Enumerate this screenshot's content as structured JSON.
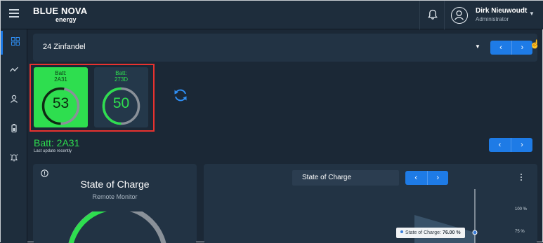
{
  "brand": {
    "name_line1": "BLUE NOVA",
    "name_line2": "energy"
  },
  "user": {
    "name": "Dirk Nieuwoudt",
    "role": "Administrator"
  },
  "icons": {
    "menu": "hamburger-icon",
    "bell": "bell-icon",
    "avatar": "user-icon",
    "sidebar": [
      "dashboard-icon",
      "trend-icon",
      "person-icon",
      "battery-icon",
      "alarm-icon"
    ],
    "refresh": "refresh-icon",
    "info": "info-icon"
  },
  "site_select": {
    "value": "24 Zinfandel",
    "prev": "‹",
    "next": "›"
  },
  "batteries": [
    {
      "label_line1": "Batt:",
      "label_line2": "2A31",
      "value": "53",
      "fraction": 0.53,
      "selected": true
    },
    {
      "label_line1": "Batt:",
      "label_line2": "273D",
      "value": "50",
      "fraction": 0.5,
      "selected": false
    }
  ],
  "battery_detail": {
    "title": "Batt: 2A31",
    "subtitle": "Last update recently",
    "prev": "‹",
    "next": "›"
  },
  "soc_card": {
    "title": "State of Charge",
    "subtitle": "Remote Monitor"
  },
  "chart_panel": {
    "tab_label": "State of Charge",
    "prev": "‹",
    "next": "›",
    "y_ticks": [
      "100 %",
      "75 %"
    ],
    "tooltip_label": "State of Charge:",
    "tooltip_value": "76.00 %"
  },
  "colors": {
    "accent": "#1e7be6",
    "battery_active": "#2ede4f",
    "panel": "#223344",
    "background": "#1b2836",
    "selection": "#e8322f"
  }
}
